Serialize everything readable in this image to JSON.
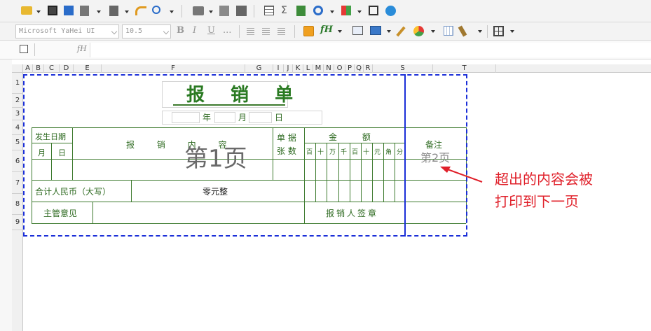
{
  "toolbar": {
    "font_name": "Microsoft YaHei UI",
    "font_size": "10.5",
    "bold": "B",
    "italic": "I",
    "underline": "U",
    "more": "...",
    "sum_icon_label": "Σ",
    "fx_label": "fH"
  },
  "formula_bar": {
    "fx_label": "fH",
    "content": ""
  },
  "columns": [
    "A",
    "B",
    "C",
    "D",
    "E",
    "F",
    "G",
    "I",
    "J",
    "K",
    "L",
    "M",
    "N",
    "O",
    "P",
    "Q",
    "R",
    "S",
    "T"
  ],
  "rows": [
    "1",
    "2",
    "3",
    "4",
    "5",
    "6",
    "7",
    "8",
    "9"
  ],
  "form": {
    "title": "报 销 单",
    "date_year": "年",
    "date_month": "月",
    "date_day": "日",
    "col_date": "发生日期",
    "col_month": "月",
    "col_day": "日",
    "col_content": "报 销 内 容",
    "col_docs_1": "单 据",
    "col_docs_2": "张 数",
    "col_amount": "金 额",
    "amount_units": [
      "百",
      "十",
      "万",
      "千",
      "百",
      "十",
      "元",
      "角",
      "分"
    ],
    "col_remark": "备注",
    "total_label": "合计人民币（大写）",
    "total_value": "零元整",
    "supervisor": "主管意见",
    "signature": "报销人签章"
  },
  "page_labels": {
    "page1": "第1页",
    "page2": "第2页"
  },
  "annotation": {
    "line1": "超出的内容会被",
    "line2": "打印到下一页"
  },
  "colors": {
    "form_green": "#2f6b22",
    "page_border_blue": "#1b2fd8",
    "annotation_red": "#e0202a"
  }
}
